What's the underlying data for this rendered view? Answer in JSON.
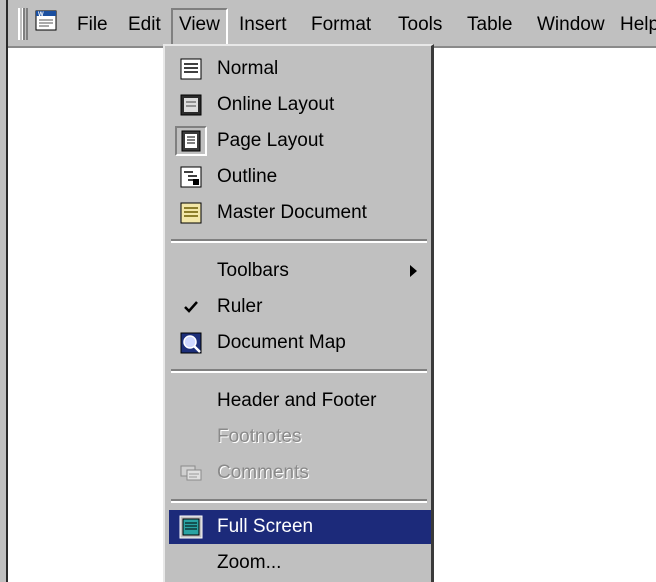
{
  "menubar": {
    "items": [
      {
        "label": "File"
      },
      {
        "label": "Edit"
      },
      {
        "label": "View"
      },
      {
        "label": "Insert"
      },
      {
        "label": "Format"
      },
      {
        "label": "Tools"
      },
      {
        "label": "Table"
      },
      {
        "label": "Window"
      },
      {
        "label": "Help"
      }
    ]
  },
  "view_menu": {
    "items": [
      {
        "label": "Normal",
        "icon": "normal-view-icon"
      },
      {
        "label": "Online Layout",
        "icon": "online-layout-icon"
      },
      {
        "label": "Page Layout",
        "icon": "page-layout-icon",
        "checked": true
      },
      {
        "label": "Outline",
        "icon": "outline-view-icon"
      },
      {
        "label": "Master Document",
        "icon": "master-document-icon"
      },
      {
        "label": "Toolbars",
        "submenu": true
      },
      {
        "label": "Ruler",
        "icon": "checkmark-icon",
        "checked": true
      },
      {
        "label": "Document Map",
        "icon": "document-map-icon"
      },
      {
        "label": "Header and Footer"
      },
      {
        "label": "Footnotes",
        "disabled": true
      },
      {
        "label": "Comments",
        "icon": "comments-icon",
        "disabled": true
      },
      {
        "label": "Full Screen",
        "icon": "full-screen-icon",
        "highlighted": true
      },
      {
        "label": "Zoom..."
      }
    ]
  },
  "colors": {
    "menu_bg": "#c0c0c0",
    "highlight": "#1c2a7a",
    "disabled_text": "#8a8a8a"
  }
}
